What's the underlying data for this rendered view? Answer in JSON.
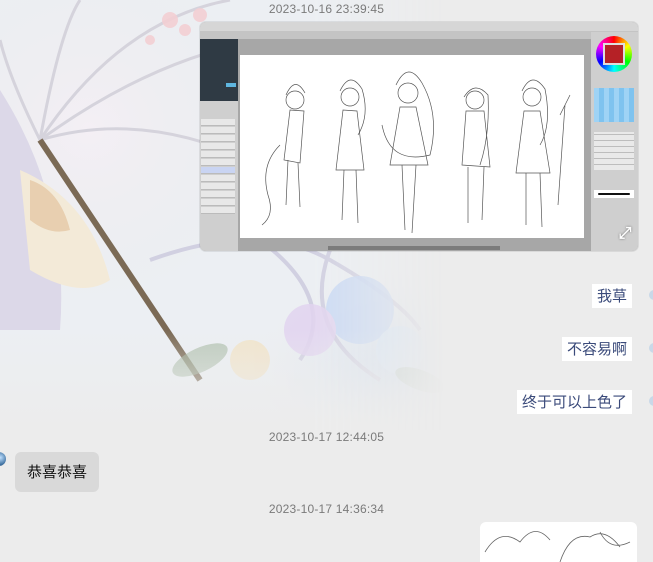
{
  "messages": [
    {
      "type": "timestamp",
      "text": "2023-10-16 23:39:45"
    },
    {
      "type": "image",
      "side": "right",
      "icon": "expand-icon"
    },
    {
      "type": "text",
      "side": "right",
      "text": "我草"
    },
    {
      "type": "text",
      "side": "right",
      "text": "不容易啊"
    },
    {
      "type": "text",
      "side": "right",
      "text": "终于可以上色了"
    },
    {
      "type": "timestamp",
      "text": "2023-10-17 12:44:05"
    },
    {
      "type": "text",
      "side": "left",
      "text": "恭喜恭喜"
    },
    {
      "type": "timestamp",
      "text": "2023-10-17 14:36:34"
    },
    {
      "type": "image",
      "side": "right"
    }
  ],
  "colors": {
    "background": "#ececec",
    "right_bubble_bg": "#ffffff",
    "right_bubble_text": "#3a4a7a",
    "left_bubble_bg": "#d9d9d9",
    "timestamp": "#7a7a7a"
  }
}
